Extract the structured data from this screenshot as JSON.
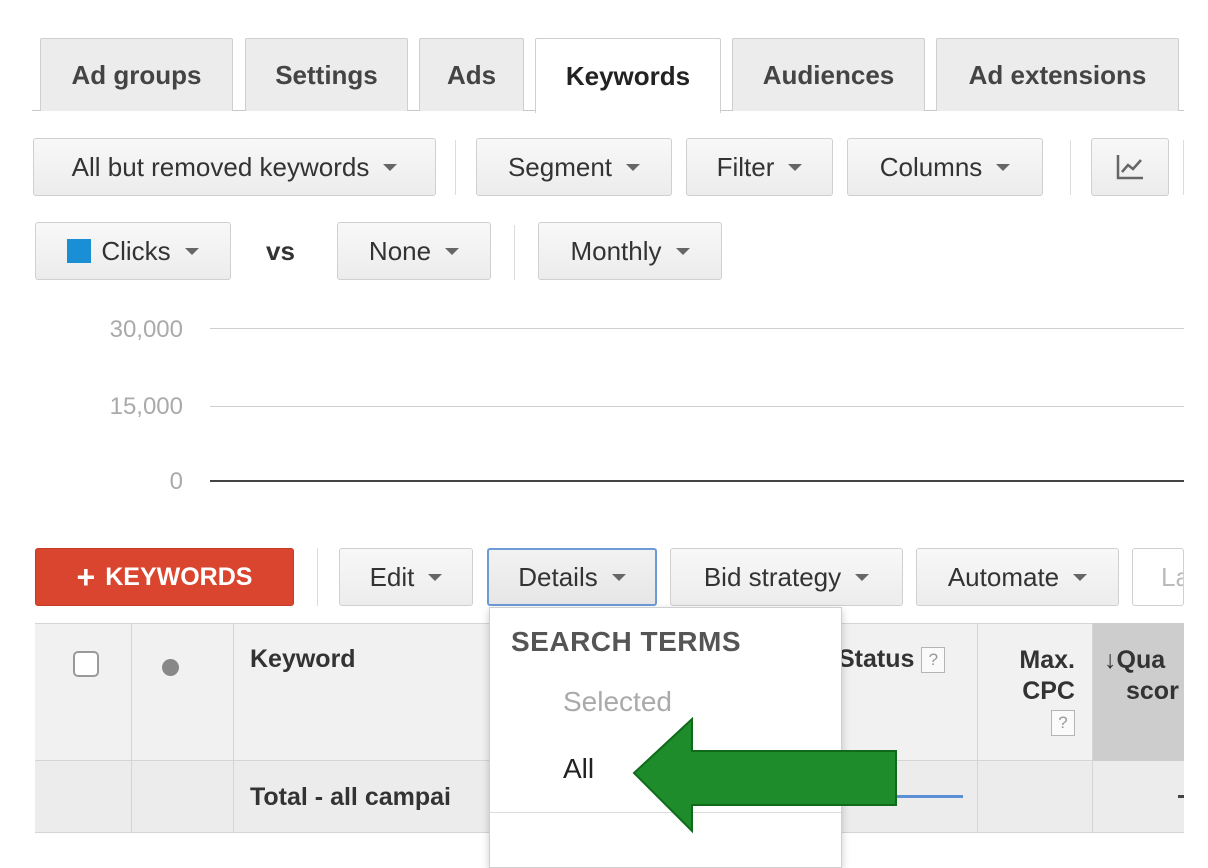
{
  "tabs": [
    {
      "label": "Ad groups",
      "active": false
    },
    {
      "label": "Settings",
      "active": false
    },
    {
      "label": "Ads",
      "active": false
    },
    {
      "label": "Keywords",
      "active": true
    },
    {
      "label": "Audiences",
      "active": false
    },
    {
      "label": "Ad extensions",
      "active": false
    }
  ],
  "toolbar": {
    "keyword_filter": "All but removed keywords",
    "segment": "Segment",
    "filter": "Filter",
    "columns": "Columns",
    "chart_icon": "line-chart-icon"
  },
  "chart_controls": {
    "metric1": "Clicks",
    "metric1_color": "#1a8fd6",
    "vs": "vs",
    "metric2": "None",
    "period": "Monthly"
  },
  "chart_data": {
    "type": "line",
    "y_ticks": [
      "30,000",
      "15,000",
      "0"
    ],
    "ylim": [
      0,
      30000
    ],
    "series": []
  },
  "actions": {
    "add_keywords": "KEYWORDS",
    "edit": "Edit",
    "details": "Details",
    "bid_strategy": "Bid strategy",
    "automate": "Automate",
    "labels_partial": "La"
  },
  "table": {
    "headers": {
      "keyword": "Keyword",
      "status": "Status",
      "max_cpc_line1": "Max.",
      "max_cpc_line2": "CPC",
      "quality_line1": "Qua",
      "quality_line2": "scor",
      "help": "?"
    },
    "total_row": "Total - all campai"
  },
  "details_menu": {
    "header": "SEARCH TERMS",
    "selected": "Selected",
    "all": "All"
  },
  "colors": {
    "add_button": "#d9452f",
    "annotation_arrow": "#1e8c2a",
    "focus_border": "#6e9bd8"
  }
}
